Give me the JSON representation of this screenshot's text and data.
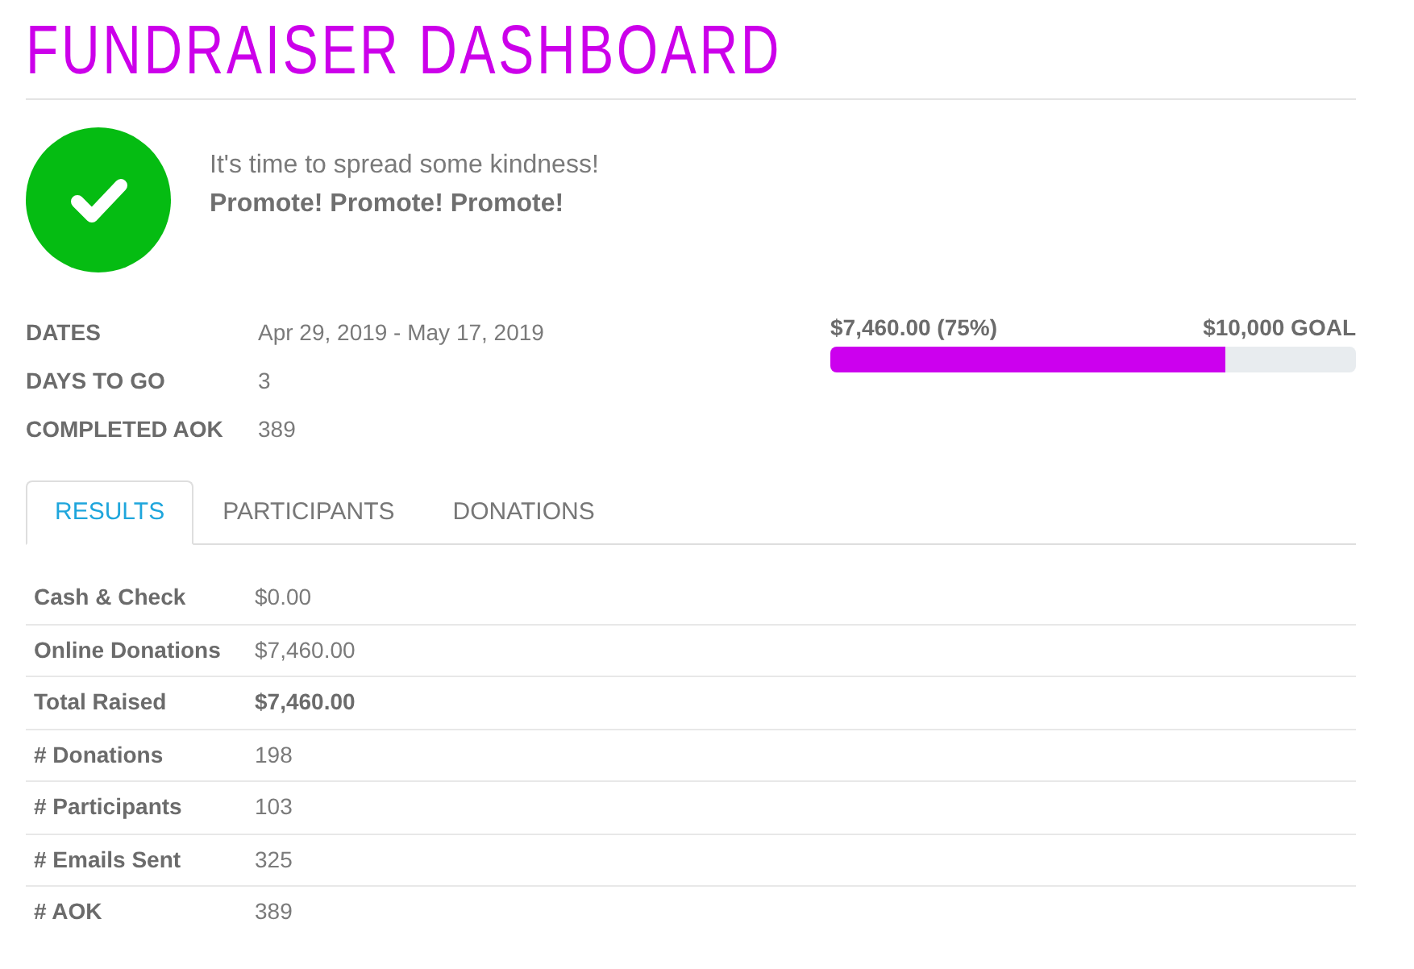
{
  "title": "FUNDRAISER DASHBOARD",
  "status": {
    "kind": "success",
    "message": "It's time to spread some kindness!",
    "emphasis": "Promote! Promote! Promote!"
  },
  "details": [
    {
      "label": "DATES",
      "value": "Apr 29, 2019 - May 17, 2019"
    },
    {
      "label": "DAYS TO GO",
      "value": "3"
    },
    {
      "label": "COMPLETED AOK",
      "value": "389"
    }
  ],
  "progress": {
    "raised": "$7,460.00 (75%)",
    "goal": "$10,000 GOAL",
    "level": 0.75
  },
  "tabs": [
    {
      "label": "RESULTS",
      "selected": true
    },
    {
      "label": "PARTICIPANTS",
      "selected": false
    },
    {
      "label": "DONATIONS",
      "selected": false
    }
  ],
  "results": [
    {
      "label": "Cash & Check",
      "value": "$0.00",
      "emphasized": false
    },
    {
      "label": "Online Donations",
      "value": "$7,460.00",
      "emphasized": false
    },
    {
      "label": "Total Raised",
      "value": "$7,460.00",
      "emphasized": true
    },
    {
      "label": "# Donations",
      "value": "198",
      "emphasized": false
    },
    {
      "label": "# Participants",
      "value": "103",
      "emphasized": false
    },
    {
      "label": "# Emails Sent",
      "value": "325",
      "emphasized": false
    },
    {
      "label": "# AOK",
      "value": "389",
      "emphasized": false
    }
  ]
}
